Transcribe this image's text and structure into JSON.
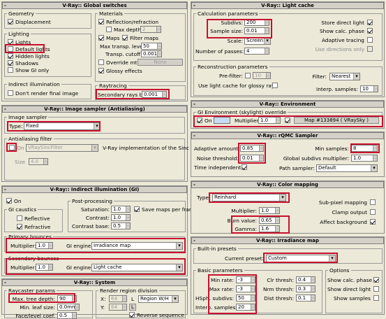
{
  "colors": {
    "highlight": "#c8102e",
    "panel_bg": "#ece9d8",
    "sky_swatch": "#c7dcf3"
  },
  "global": {
    "title": "V-Ray:: Global switches",
    "geometry": {
      "title": "Geometry",
      "displacement": "Displacement"
    },
    "lighting": {
      "title": "Lighting",
      "lights": "Lights",
      "default_lights": "Default lights",
      "hidden_lights": "Hidden lights",
      "shadows": "Shadows",
      "show_gi_only": "Show GI only"
    },
    "indirect": {
      "title": "Indirect illumination",
      "dont_render_final": "Don't render final image"
    },
    "materials": {
      "title": "Materials",
      "reflection_refraction": "Reflection/refraction",
      "max_depth": "Max depth",
      "max_depth_value": "2",
      "maps": "Maps",
      "filter_maps": "Filter maps",
      "max_transp": "Max transp. levels",
      "max_transp_value": "50",
      "transp_cutoff": "Transp. cutoff",
      "transp_cutoff_value": "0.001",
      "override_mtl": "Override mtl:",
      "override_btn": "None",
      "glossy": "Glossy effects"
    },
    "raytracing": {
      "title": "Raytracing",
      "bias_label": "Secondary rays bias",
      "bias_value": "0.001"
    }
  },
  "sampler": {
    "title": "V-Ray:: Image sampler (Antialiasing)",
    "group": "Image sampler",
    "type_label": "Type:",
    "type_value": "Fixed",
    "aa_group": "Antialiasing filter",
    "on": "On",
    "filter_value": "VRaySincFilter",
    "filter_desc": "V-Ray implementation of the Sinc filter.",
    "size_label": "Size",
    "size_value": "4.0"
  },
  "gi": {
    "title": "V-Ray:: Indirect illumination (GI)",
    "on": "On",
    "caustics": {
      "title": "GI caustics",
      "reflective": "Reflective",
      "refractive": "Refractive"
    },
    "post": {
      "title": "Post-processing",
      "saturation": "Saturation:",
      "saturation_value": "1.0",
      "contrast": "Contrast:",
      "contrast_value": "1.0",
      "contrast_base": "Contrast base:",
      "contrast_base_value": "0.5",
      "save_maps": "Save maps per frame"
    },
    "primary": {
      "title": "Primary bounces",
      "multiplier": "Multiplier:",
      "multiplier_value": "1.0",
      "engine_label": "GI engine:",
      "engine_value": "Irradiance map"
    },
    "secondary": {
      "title": "Secondary bounces",
      "multiplier": "Multiplier:",
      "multiplier_value": "1.0",
      "engine_label": "GI engine:",
      "engine_value": "Light cache"
    }
  },
  "system": {
    "title": "V-Ray:: System",
    "raycaster": {
      "title": "Raycaster params",
      "max_tree": "Max. tree depth:",
      "max_tree_value": "90",
      "min_leaf": "Min. leaf size:",
      "min_leaf_value": "0.0mm",
      "face_level": "Face/level coef.",
      "face_level_value": "0.5"
    },
    "region": {
      "title": "Render region division",
      "x": "X:",
      "x_value": "64",
      "y": "Y:",
      "y_value": "64",
      "l": "L",
      "mode": "Region W/H",
      "reverse": "Reverse sequence"
    }
  },
  "light_cache": {
    "title": "V-Ray:: Light cache",
    "calc_title": "Calculation parameters",
    "subdivs": "Subdivs:",
    "subdivs_value": "200",
    "sample_size": "Sample size:",
    "sample_size_value": "0.01",
    "scale": "Scale:",
    "scale_value": "Screen",
    "passes": "Number of passes:",
    "passes_value": "4",
    "store_direct": "Store direct light",
    "show_calc": "Show calc. phase",
    "adaptive_tracing": "Adaptive tracing",
    "use_directions": "Use directions only",
    "recon_title": "Reconstruction parameters",
    "prefilter": "Pre-filter:",
    "prefilter_value": "10",
    "filter": "Filter:",
    "filter_value": "Nearest",
    "use_glossy": "Use light cache for glossy rays",
    "interp": "Interp. samples:",
    "interp_value": "10"
  },
  "environment": {
    "title": "V-Ray:: Environment",
    "group": "GI Environment (skylight) override",
    "on": "On",
    "multiplier": "Multiplier:",
    "multiplier_value": "1.0",
    "map": "Map #133894  ( VRaySky )"
  },
  "dmc": {
    "title": "V-Ray:: rQMC Sampler",
    "adaptive_amount": "Adaptive amount:",
    "adaptive_amount_value": "0.85",
    "noise": "Noise threshold:",
    "noise_value": "0.01",
    "time_independent": "Time independent",
    "min_samples": "Min samples:",
    "min_samples_value": "8",
    "global_subdivs": "Global subdivs multiplier:",
    "global_subdivs_value": "1.0",
    "path_sampler": "Path sampler:",
    "path_sampler_value": "Default"
  },
  "color_mapping": {
    "title": "V-Ray:: Color mapping",
    "type_label": "Type:",
    "type_value": "Reinhard",
    "multiplier": "Multiplier:",
    "multiplier_value": "1.0",
    "burn": "Burn value:",
    "burn_value": "0.65",
    "gamma": "Gamma:",
    "gamma_value": "1.6",
    "subpixel": "Sub-pixel mapping",
    "clamp": "Clamp output",
    "affect_bg": "Affect background"
  },
  "irradiance": {
    "title": "V-Ray:: Irradiance map",
    "presets_title": "Built-in presets",
    "current_preset": "Current preset:",
    "current_preset_value": "Custom",
    "basic_title": "Basic parameters",
    "min_rate": "Min rate:",
    "min_rate_value": "-3",
    "max_rate": "Max rate:",
    "max_rate_value": "-3",
    "hsph": "HSph. subdivs:",
    "hsph_value": "50",
    "interp": "Interp. samples:",
    "interp_value": "20",
    "clr": "Clr thresh:",
    "clr_value": "0.4",
    "nrm": "Nrm thresh:",
    "nrm_value": "0.3",
    "dist": "Dist thresh:",
    "dist_value": "0.1",
    "options_title": "Options",
    "show_calc": "Show calc. phase",
    "show_direct": "Show direct light",
    "show_samples": "Show samples"
  }
}
